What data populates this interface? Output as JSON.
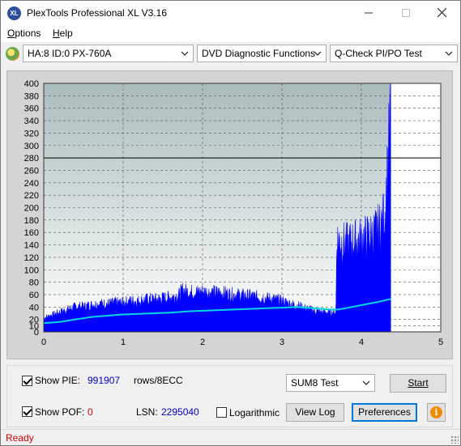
{
  "window": {
    "title": "PlexTools Professional XL V3.16",
    "icon_text": "XL",
    "minimize_icon": "minimize-icon",
    "maximize_icon": "maximize-icon",
    "close_icon": "close-icon"
  },
  "menu": {
    "options_label": "Options",
    "options_accel": "O",
    "options_rest": "ptions",
    "help_label": "Help",
    "help_accel": "H",
    "help_rest": "elp"
  },
  "toolbar": {
    "drive": "HA:8 ID:0  PX-760A",
    "function": "DVD Diagnostic Functions",
    "test": "Q-Check PI/PO Test"
  },
  "chart_data": {
    "type": "area",
    "title": "",
    "xlabel": "",
    "ylabel": "",
    "xlim": [
      0,
      5
    ],
    "ylim": [
      0,
      400
    ],
    "x_ticks": [
      0,
      1,
      2,
      3,
      4,
      5
    ],
    "y_ticks": [
      0,
      10,
      20,
      40,
      60,
      80,
      100,
      120,
      140,
      160,
      180,
      200,
      220,
      240,
      260,
      280,
      300,
      320,
      340,
      360,
      380,
      400
    ],
    "threshold_line": 280,
    "grid": true,
    "data_extent_x": 4.37,
    "colors": {
      "pie_fill": "#0000ff",
      "sum_line": "#00d8e0",
      "threshold": "#000000",
      "plot_bg_top": "#a9bcbc",
      "plot_bg_bottom": "#ffffff"
    },
    "series": [
      {
        "name": "PIE",
        "x": [
          0,
          0.1,
          0.2,
          0.3,
          0.4,
          0.5,
          0.6,
          0.7,
          0.8,
          0.9,
          1.0,
          1.1,
          1.2,
          1.3,
          1.4,
          1.5,
          1.6,
          1.7,
          1.75,
          1.8,
          1.9,
          2.0,
          2.1,
          2.2,
          2.3,
          2.4,
          2.5,
          2.6,
          2.7,
          2.8,
          2.9,
          3.0,
          3.1,
          3.2,
          3.3,
          3.4,
          3.5,
          3.6,
          3.68,
          3.69,
          3.8,
          3.9,
          4.0,
          4.1,
          4.2,
          4.25,
          4.3,
          4.33,
          4.35,
          4.37
        ],
        "values": [
          25,
          30,
          35,
          40,
          45,
          45,
          48,
          50,
          50,
          52,
          52,
          55,
          55,
          58,
          58,
          60,
          62,
          65,
          75,
          72,
          70,
          72,
          70,
          70,
          68,
          66,
          65,
          64,
          62,
          60,
          58,
          55,
          50,
          47,
          42,
          38,
          35,
          35,
          35,
          170,
          160,
          165,
          170,
          175,
          185,
          195,
          220,
          300,
          350,
          400
        ]
      },
      {
        "name": "SUM8",
        "x": [
          0,
          0.2,
          0.4,
          0.6,
          0.8,
          1.0,
          1.2,
          1.4,
          1.6,
          1.8,
          2.0,
          2.2,
          2.4,
          2.6,
          2.8,
          3.0,
          3.2,
          3.4,
          3.6,
          3.7,
          3.8,
          4.0,
          4.2,
          4.37
        ],
        "values": [
          14,
          16,
          20,
          24,
          26,
          28,
          29,
          30,
          31,
          33,
          34,
          35,
          36,
          37,
          38,
          39,
          40,
          38,
          36,
          36,
          38,
          43,
          48,
          53
        ]
      }
    ]
  },
  "stats": {
    "show_pie_label": "Show PIE:",
    "pie_value": "991907",
    "rows_label": "rows/8ECC",
    "show_pof_label": "Show POF:",
    "pof_value": "0",
    "lsn_label": "LSN:",
    "lsn_value": "2295040",
    "logarithmic_label": "Logarithmic"
  },
  "controls": {
    "test_mode": "SUM8 Test",
    "start_label": "Start",
    "view_log_label": "View Log",
    "preferences_label": "Preferences",
    "info_icon": "info-icon"
  },
  "status": {
    "text": "Ready"
  }
}
